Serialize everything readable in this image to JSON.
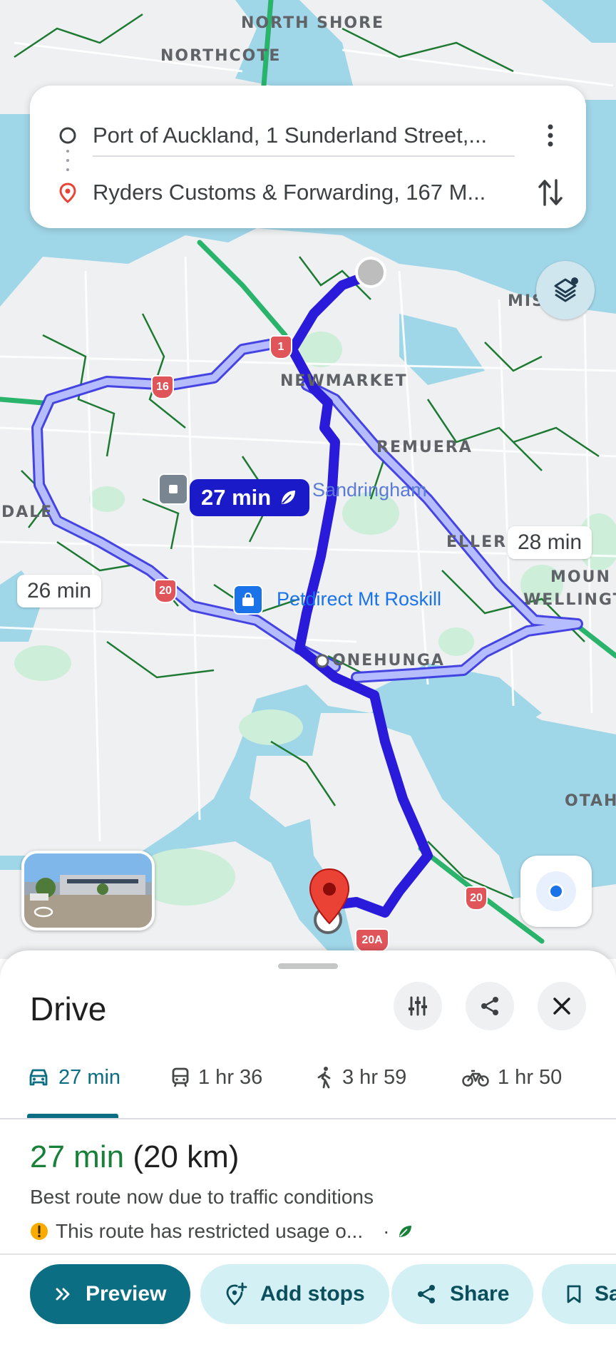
{
  "map": {
    "labels": {
      "north_shore": "NORTH SHORE",
      "northcote": "NORTHCOTE",
      "newmarket": "NEWMARKET",
      "remuera": "REMUERA",
      "ellerslie": "ELLERS",
      "mount_wellington_1": "MOUN",
      "mount_wellington_2": "WELLINGT",
      "onehunga": "ONEHUNGA",
      "otahuhu": "OTAH",
      "mission_bay": "MISS",
      "dale": "DALE"
    },
    "pois": {
      "sandringham": "Sandringham",
      "petdirect": "Petdirect Mt Roskill"
    },
    "shields": [
      "1",
      "16",
      "20",
      "20",
      "20A"
    ],
    "routes": {
      "selected_duration": "27 min",
      "alt_east_duration": "28 min",
      "alt_west_duration": "26 min"
    }
  },
  "search": {
    "origin": "Port of Auckland, 1 Sunderland Street,...",
    "destination": "Ryders Customs & Forwarding, 167 M..."
  },
  "sheet": {
    "title": "Drive",
    "tabs": [
      {
        "label": "27 min",
        "icon": "car-icon"
      },
      {
        "label": "1 hr 36",
        "icon": "transit-icon"
      },
      {
        "label": "3 hr 59",
        "icon": "walk-icon"
      },
      {
        "label": "1 hr 50",
        "icon": "bike-icon"
      }
    ],
    "route": {
      "time": "27 min",
      "distance": "(20 km)",
      "subtitle": "Best route now due to traffic conditions",
      "warning": "This route has restricted usage o...",
      "separator": "·"
    },
    "actions": {
      "preview": "Preview",
      "add_stops": "Add stops",
      "share": "Share",
      "save": "Sa"
    }
  },
  "colors": {
    "route_selected": "#2a1ad9",
    "route_alt": "#a8b4ff",
    "water": "#9fd6e8",
    "accent": "#0b6e82",
    "eco_green": "#188038"
  }
}
